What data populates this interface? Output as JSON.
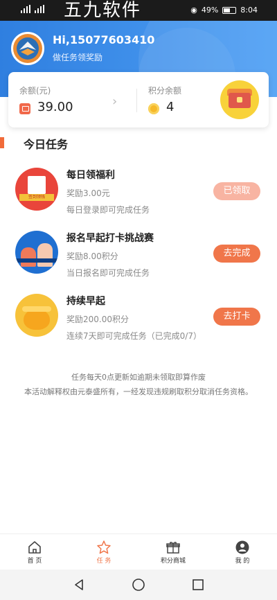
{
  "status_bar": {
    "watermark": "五九软件",
    "battery": "49%",
    "time": "8:04"
  },
  "header": {
    "greeting": "Hi,15077603410",
    "subtitle": "做任务领奖励"
  },
  "balance_card": {
    "balance_label": "余额(元)",
    "balance_value": "39.00",
    "points_label": "积分余额",
    "points_value": "4"
  },
  "section": {
    "title": "今日任务"
  },
  "tasks": [
    {
      "title": "每日领福利",
      "reward": "奖励3.00元",
      "desc": "每日登录即可完成任务",
      "button": "已领取",
      "ribbon": "签到领钱"
    },
    {
      "title": "报名早起打卡挑战赛",
      "reward": "奖励8.00积分",
      "desc": "当日报名即可完成任务",
      "button": "去完成"
    },
    {
      "title": "持续早起",
      "reward": "奖励200.00积分",
      "desc": "连续7天即可完成任务（已完成0/7）",
      "button": "去打卡"
    }
  ],
  "notes": {
    "line1": "任务每天0点更新如逾期未领取即算作废",
    "line2": "本活动解释权由元泰盛所有，一经发现违规刷取积分取消任务资格。"
  },
  "nav": [
    {
      "label": "首 页",
      "icon": "home-icon",
      "active": false
    },
    {
      "label": "任 务",
      "icon": "star-icon",
      "active": true
    },
    {
      "label": "积分商城",
      "icon": "gift-icon",
      "active": false
    },
    {
      "label": "我 的",
      "icon": "user-icon",
      "active": false
    }
  ],
  "colors": {
    "header_blue": "#2f7fe0",
    "accent_orange": "#f0764a",
    "claimed_pink": "#f8b4a2"
  }
}
